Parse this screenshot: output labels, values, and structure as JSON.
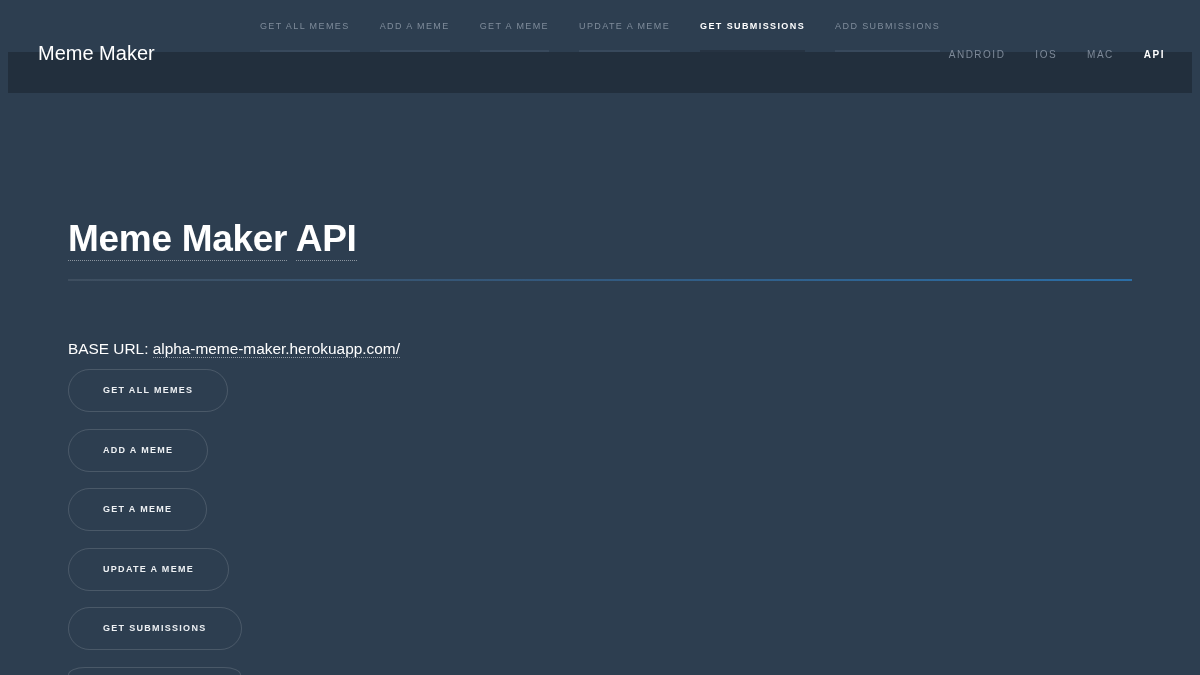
{
  "top_nav": {
    "tabs": [
      {
        "label": "GET ALL MEMES",
        "selected": false
      },
      {
        "label": "ADD A MEME",
        "selected": false
      },
      {
        "label": "GET A MEME",
        "selected": false
      },
      {
        "label": "UPDATE A MEME",
        "selected": false
      },
      {
        "label": "GET SUBMISSIONS",
        "selected": true
      },
      {
        "label": "ADD SUBMISSIONS",
        "selected": false
      }
    ]
  },
  "header": {
    "site_title": "Meme Maker",
    "links": [
      {
        "label": "ANDROID",
        "selected": false
      },
      {
        "label": "IOS",
        "selected": false
      },
      {
        "label": "MAC",
        "selected": false
      },
      {
        "label": "API",
        "selected": true
      }
    ]
  },
  "page": {
    "title": [
      "Meme Maker",
      "API"
    ],
    "base_url": {
      "label": "BASE URL:",
      "link": "alpha-meme-maker.herokuapp.com/"
    },
    "buttons": [
      {
        "kind": "labeled",
        "label": "GET ALL MEMES"
      },
      {
        "kind": "labeled",
        "label": "ADD A MEME"
      },
      {
        "kind": "labeled",
        "label": "GET A MEME"
      },
      {
        "kind": "labeled",
        "label": "UPDATE A MEME"
      },
      {
        "kind": "labeled",
        "label": "GET SUBMISSIONS"
      },
      {
        "kind": "cut-off"
      }
    ]
  }
}
